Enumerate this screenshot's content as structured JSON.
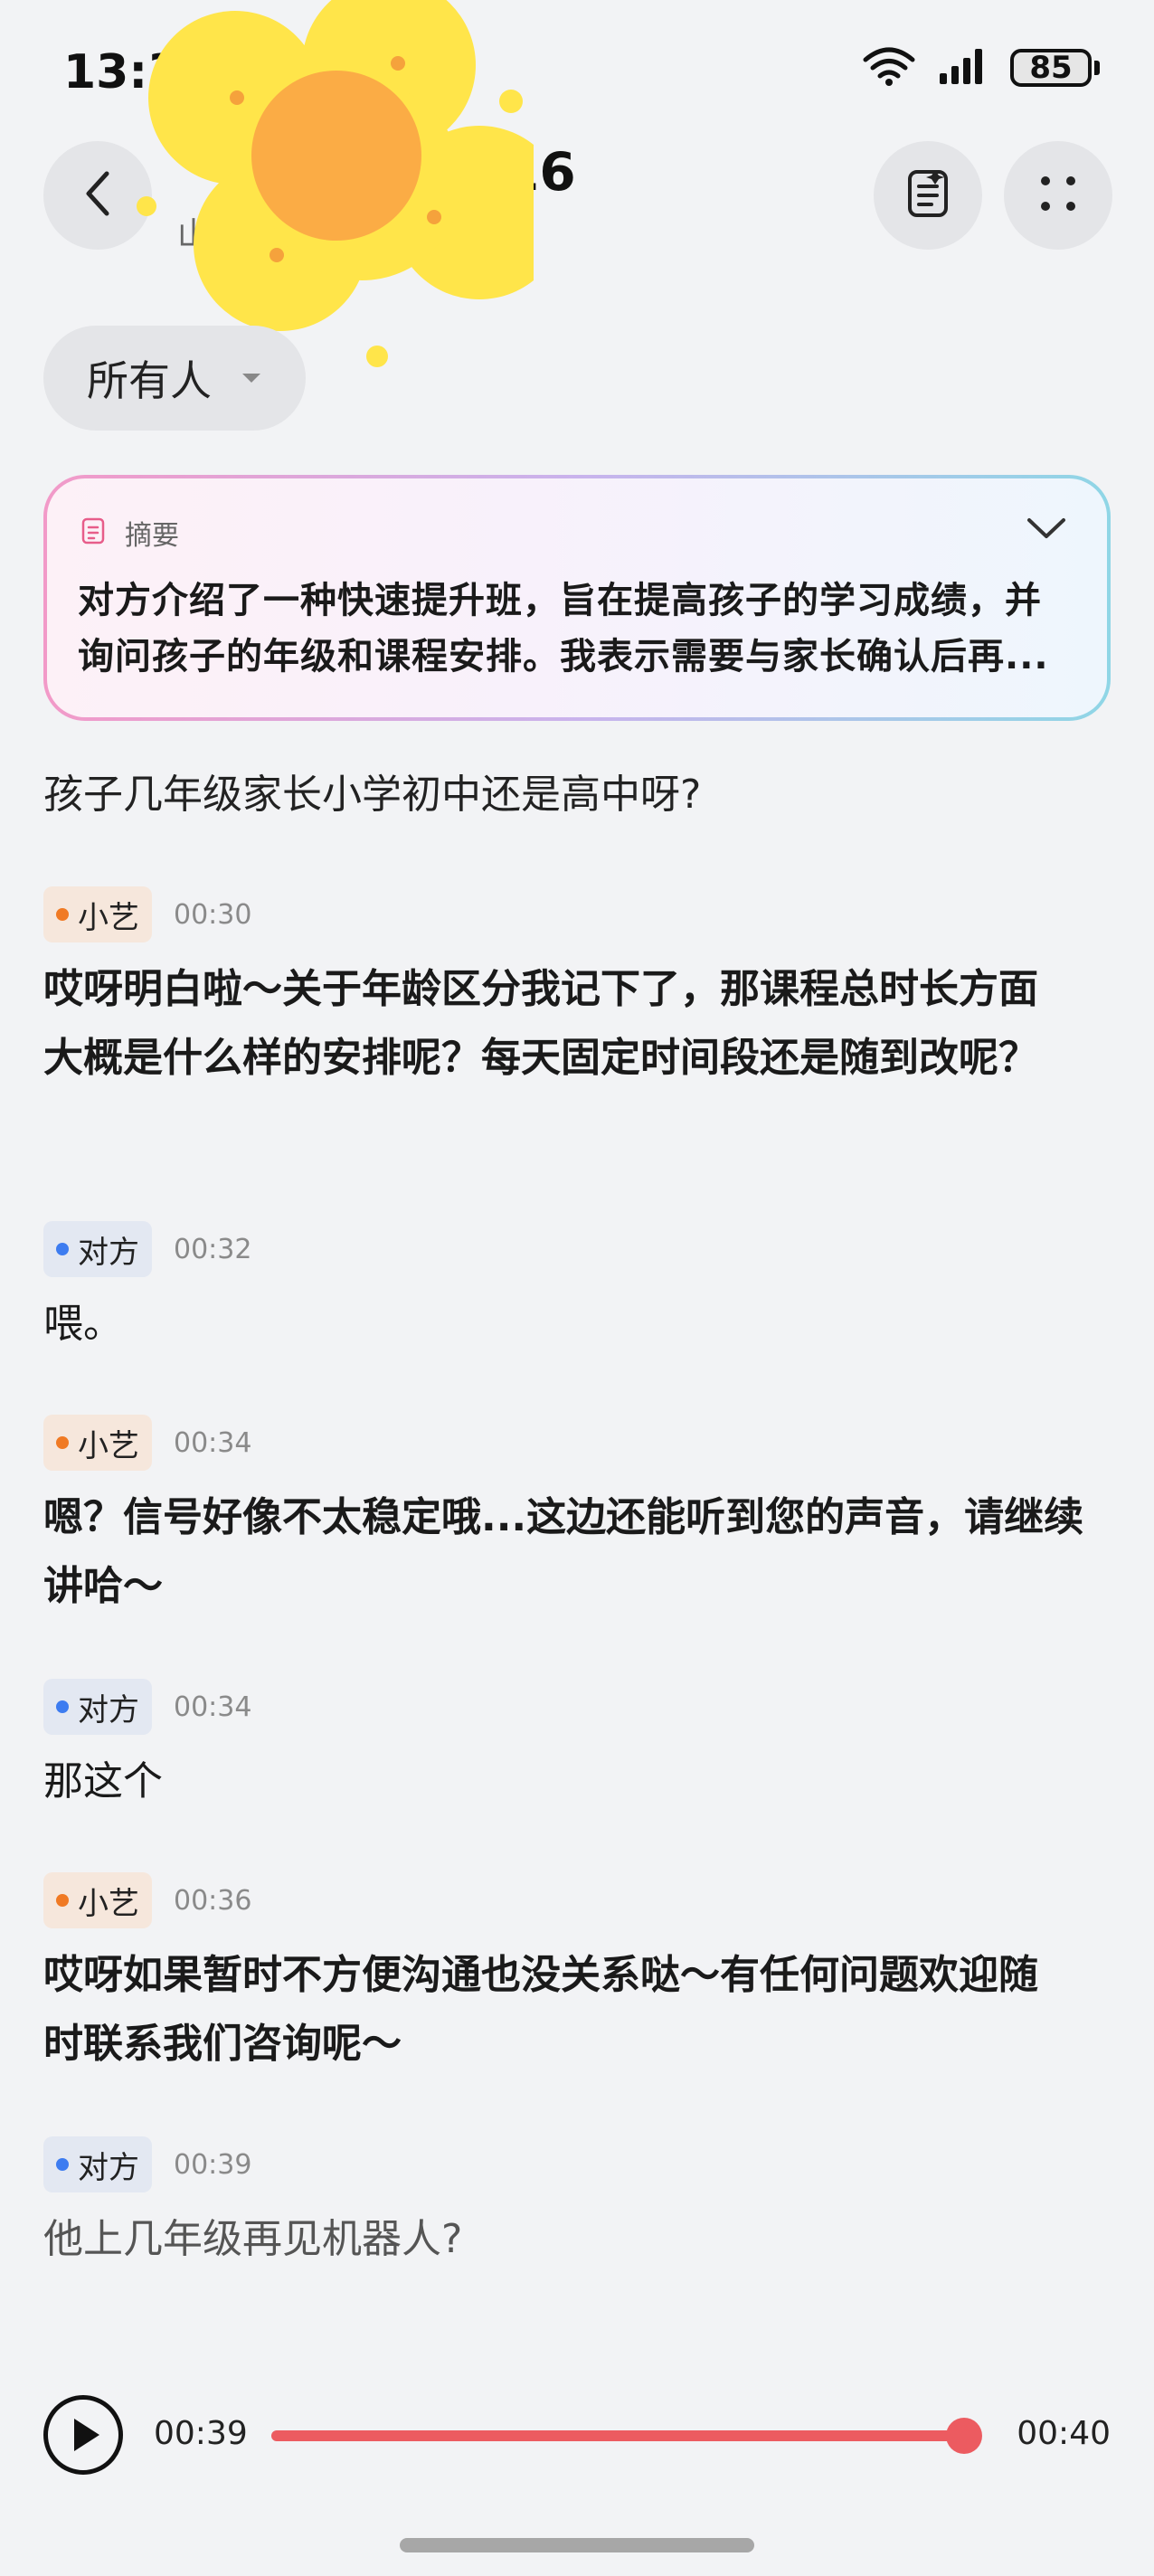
{
  "status_bar": {
    "time": "13:3",
    "battery": "85"
  },
  "header": {
    "title": "16",
    "subtitle": "山",
    "back_icon": "chevron-left-icon",
    "summary_icon": "document-list-icon",
    "more_icon": "four-dots-icon"
  },
  "filter": {
    "label": "所有人"
  },
  "summary": {
    "label": "摘要",
    "text": "对方介绍了一种快速提升班，旨在提高孩子的学习成绩，并询问孩子的年级和课程安排。我表示需要与家长确认后再..."
  },
  "transcript": {
    "intro_line": "孩子几年级家长小学初中还是高中呀?",
    "messages": [
      {
        "speaker": "小艺",
        "time": "00:30",
        "text": "哎呀明白啦～关于年龄区分我记下了，那课程总时长方面大概是什么样的安排呢？每天固定时间段还是随到改呢？"
      },
      {
        "speaker": "对方",
        "time": "00:32",
        "text": "喂。"
      },
      {
        "speaker": "小艺",
        "time": "00:34",
        "text": "嗯？信号好像不太稳定哦...这边还能听到您的声音，请继续讲哈～"
      },
      {
        "speaker": "对方",
        "time": "00:34",
        "text": "那这个"
      },
      {
        "speaker": "小艺",
        "time": "00:36",
        "text": "哎呀如果暂时不方便沟通也没关系哒～有任何问题欢迎随时联系我们咨询呢～"
      },
      {
        "speaker": "对方",
        "time": "00:39",
        "text": "他上几年级再见机器人?"
      }
    ]
  },
  "player": {
    "current_time": "00:39",
    "total_time": "00:40",
    "progress": 0.975
  },
  "colors": {
    "ai_accent": "#f07a24",
    "other_accent": "#3d7cf0",
    "progress": "#ec5b60"
  }
}
